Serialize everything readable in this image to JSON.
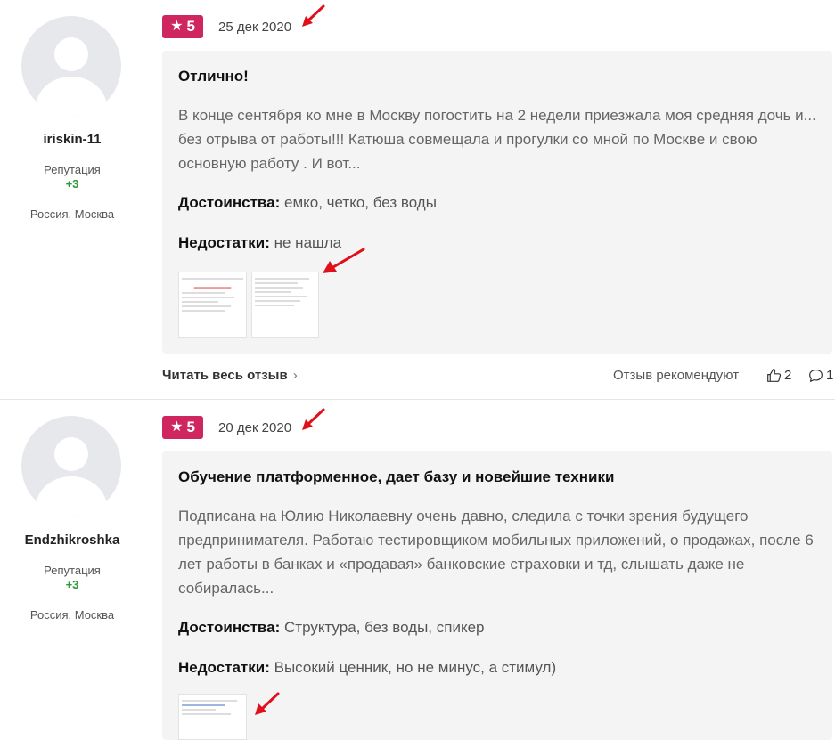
{
  "reviews": [
    {
      "user": {
        "name": "iriskin-11",
        "reputation_label": "Репутация",
        "reputation": "+3",
        "location": "Россия, Москва"
      },
      "rating": "5",
      "date": "25 дек 2020",
      "title": "Отлично!",
      "excerpt": "В конце сентября ко мне в Москву погостить на 2 недели приезжала моя средняя дочь и... без отрыва от работы!!! Катюша совмещала и прогулки со мной по Москве и свою основную работу . И вот...",
      "pros_label": "Достоинства:",
      "pros": "емко, четко, без воды",
      "cons_label": "Недостатки:",
      "cons": "не нашла",
      "read_more": "Читать весь отзыв",
      "recommend_label": "Отзыв рекомендуют",
      "likes": "2",
      "comments": "1"
    },
    {
      "user": {
        "name": "Endzhikroshka",
        "reputation_label": "Репутация",
        "reputation": "+3",
        "location": "Россия, Москва"
      },
      "rating": "5",
      "date": "20 дек 2020",
      "title": "Обучение платформенное, дает базу и новейшие техники",
      "excerpt": "Подписана на Юлию Николаевну очень давно, следила с точки зрения будущего предпринимателя. Работаю тестировщиком мобильных приложений, о продажах, после 6 лет работы в банках и «продавая» банковские страховки и тд, слышать даже не собиралась...",
      "pros_label": "Достоинства:",
      "pros": "Структура, без воды, спикер",
      "cons_label": "Недостатки:",
      "cons": "Высокий ценник, но не минус, а стимул)"
    }
  ],
  "colors": {
    "badge": "#d0265f",
    "reputation": "#2a9a3a",
    "card_bg": "#f4f4f5",
    "annotation_arrow": "#e0101a"
  },
  "icons": [
    "star-icon",
    "thumbs-up-icon",
    "comment-icon",
    "chevron-right-icon",
    "user-avatar-placeholder"
  ]
}
